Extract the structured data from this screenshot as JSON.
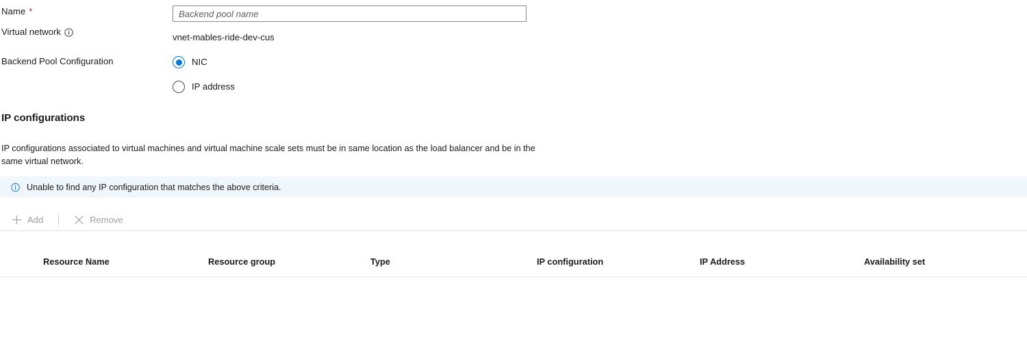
{
  "form": {
    "rows": [
      {
        "label": "Name",
        "required_marker": "*",
        "field_type": "text-input",
        "value": "",
        "placeholder": "Backend pool name"
      },
      {
        "label": "Virtual network",
        "has_info_icon": true,
        "field_type": "static-text",
        "value": "vnet-mables-ride-dev-cus"
      },
      {
        "label": "Backend Pool Configuration",
        "field_type": "radio-group",
        "options": [
          {
            "label": "NIC",
            "selected": true
          },
          {
            "label": "IP address",
            "selected": false
          }
        ]
      }
    ]
  },
  "section": {
    "title": "IP configurations",
    "description": "IP configurations associated to virtual machines and virtual machine scale sets must be in same location as the load balancer and be in the same virtual network."
  },
  "info_banner": {
    "icon": "info-circle-icon",
    "message": "Unable to find any IP configuration that matches the above criteria.",
    "background": "#eff6fc",
    "icon_color": "#0078d4"
  },
  "command_bar": {
    "add": {
      "label": "Add",
      "icon": "plus-icon",
      "disabled": true
    },
    "remove": {
      "label": "Remove",
      "icon": "close-x-icon",
      "disabled": true
    }
  },
  "table": {
    "columns": [
      "Resource Name",
      "Resource group",
      "Type",
      "IP configuration",
      "IP Address",
      "Availability set"
    ],
    "rows": []
  },
  "colors": {
    "accent": "#0078d4",
    "required": "#a4262c",
    "text": "#1b1a19",
    "disabled_text": "#a19f9d",
    "border": "#8a8886",
    "divider": "#e1dfdd"
  }
}
